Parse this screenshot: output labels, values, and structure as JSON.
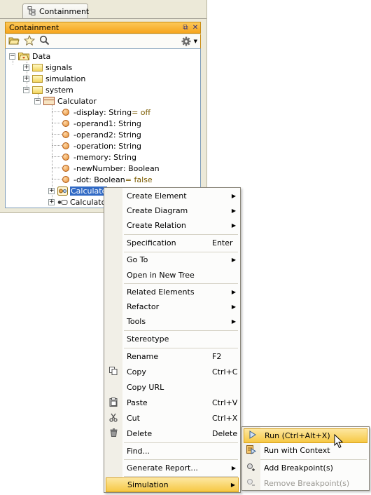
{
  "panel": {
    "tab_label": "Containment",
    "title": "Containment",
    "title_buttons": [
      "restore-icon",
      "close-icon"
    ],
    "toolbar_icons": [
      "open-folder-icon",
      "star-icon",
      "search-icon",
      "gear-icon"
    ]
  },
  "tree": {
    "nodes": [
      {
        "label": "Data",
        "icon": "package-open-icon",
        "expander": "−"
      },
      {
        "label": "signals",
        "icon": "folder-icon",
        "expander": "+"
      },
      {
        "label": "simulation",
        "icon": "folder-icon",
        "expander": "+"
      },
      {
        "label": "system",
        "icon": "folder-icon",
        "expander": "−"
      },
      {
        "label": "Calculator",
        "icon": "class-icon",
        "expander": "−"
      },
      {
        "name": "-display",
        "type": " : String",
        "value": " = off"
      },
      {
        "name": "-operand1",
        "type": " : String",
        "value": ""
      },
      {
        "name": "-operand2",
        "type": " : String",
        "value": ""
      },
      {
        "name": "-operation",
        "type": " : String",
        "value": ""
      },
      {
        "name": "-memory",
        "type": " : String",
        "value": ""
      },
      {
        "name": "-newNumber",
        "type": " : Boolean",
        "value": ""
      },
      {
        "name": "-dot",
        "type": " : Boolean",
        "value": " = false"
      },
      {
        "label": "Calculato",
        "icon": "state-machine-icon",
        "expander": "+",
        "selected": true
      },
      {
        "label": "Calculato",
        "icon": "activity-icon",
        "expander": "+"
      }
    ]
  },
  "context_menu": {
    "items": [
      {
        "label": "Create Element",
        "submenu": true
      },
      {
        "label": "Create Diagram",
        "submenu": true
      },
      {
        "label": "Create Relation",
        "submenu": true
      },
      {
        "label": "Specification",
        "shortcut": "Enter"
      },
      {
        "label": "Go To",
        "submenu": true
      },
      {
        "label": "Open in New Tree"
      },
      {
        "label": "Related Elements",
        "submenu": true
      },
      {
        "label": "Refactor",
        "submenu": true
      },
      {
        "label": "Tools",
        "submenu": true
      },
      {
        "label": "Stereotype"
      },
      {
        "label": "Rename",
        "shortcut": "F2"
      },
      {
        "label": "Copy",
        "shortcut": "Ctrl+C",
        "icon": "copy-icon"
      },
      {
        "label": "Copy URL"
      },
      {
        "label": "Paste",
        "shortcut": "Ctrl+V",
        "icon": "paste-icon"
      },
      {
        "label": "Cut",
        "shortcut": "Ctrl+X",
        "icon": "cut-icon"
      },
      {
        "label": "Delete",
        "shortcut": "Delete",
        "icon": "delete-icon"
      },
      {
        "label": "Find..."
      },
      {
        "label": "Generate Report...",
        "submenu": true
      },
      {
        "label": "Simulation",
        "submenu": true,
        "active": true
      }
    ]
  },
  "submenu": {
    "items": [
      {
        "label": "Run (Ctrl+Alt+X)",
        "icon": "run-icon",
        "active": true
      },
      {
        "label": "Run with Context",
        "icon": "run-context-icon"
      },
      {
        "label": "Add Breakpoint(s)",
        "icon": "add-breakpoint-icon"
      },
      {
        "label": "Remove Breakpoint(s)",
        "icon": "remove-breakpoint-icon",
        "disabled": true
      }
    ]
  },
  "colors": {
    "title_bar": "#f6a51d",
    "selection": "#316ac5",
    "menu_highlight": "#f6c844"
  }
}
